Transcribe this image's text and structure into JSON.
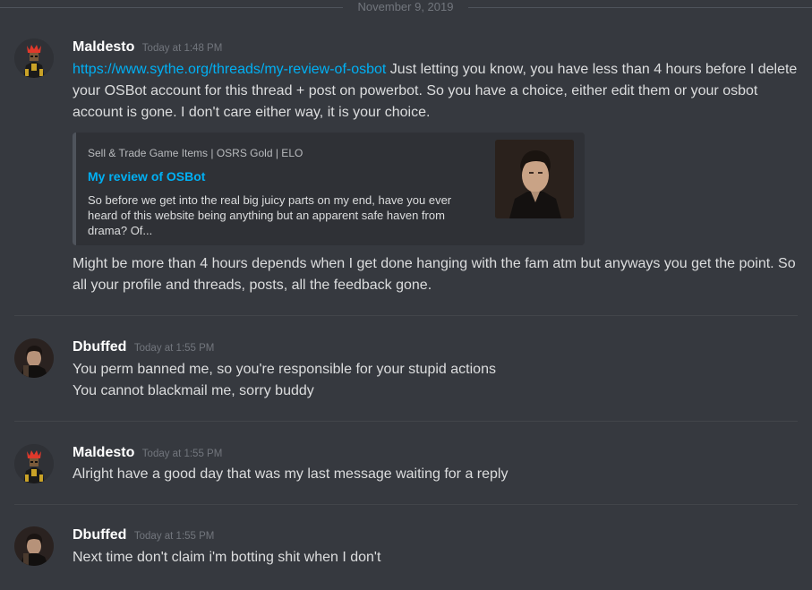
{
  "date_divider": "November 9, 2019",
  "messages": [
    {
      "username": "Maldesto",
      "timestamp": "Today at 1:48 PM",
      "link": "https://www.sythe.org/threads/my-review-of-osbot",
      "text_after_link": " Just letting you know, you have less than 4 hours before I delete your OSBot account for this thread + post on powerbot. So you have a choice, either edit them or your osbot account is gone. I don't care either way, it is your choice.",
      "embed": {
        "provider": "Sell & Trade Game Items | OSRS Gold | ELO",
        "title": "My review of OSBot",
        "description": "So before we get into the real big juicy parts on my end, have you ever heard of this website being anything but an apparent safe haven from drama? Of..."
      },
      "followup": "Might be more than 4 hours depends when I get done hanging with the fam atm but anyways you get the point. So all your profile and threads, posts, all the feedback gone."
    },
    {
      "username": "Dbuffed",
      "timestamp": "Today at 1:55 PM",
      "lines": [
        "You perm banned me, so you're responsible for your stupid actions",
        "You cannot blackmail me, sorry buddy"
      ]
    },
    {
      "username": "Maldesto",
      "timestamp": "Today at 1:55 PM",
      "text": "Alright have a good day that was my last message waiting for a reply"
    },
    {
      "username": "Dbuffed",
      "timestamp": "Today at 1:55 PM",
      "text": "Next time don't claim i'm botting shit when I don't"
    }
  ],
  "colors": {
    "background": "#36393f",
    "link": "#00b0f4",
    "username": "#ffffff",
    "timestamp": "#72767d",
    "text": "#dcddde",
    "embed_background": "#2f3136"
  }
}
